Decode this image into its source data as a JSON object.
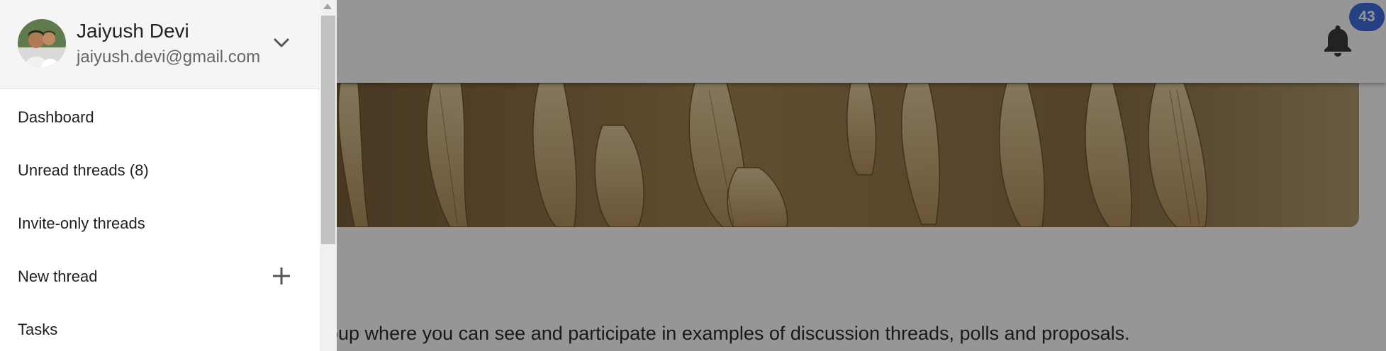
{
  "drawer": {
    "user": {
      "name": "Jaiyush Devi",
      "email": "jaiyush.devi@gmail.com",
      "avatar_icon": "avatar-photo",
      "toggle_icon": "chevron-down-icon"
    },
    "menu": [
      {
        "label": "Dashboard"
      },
      {
        "label": "Unread threads (8)"
      },
      {
        "label": "Invite-only threads"
      },
      {
        "label": "New thread",
        "icon": "plus-icon"
      },
      {
        "label": "Tasks"
      }
    ]
  },
  "header": {
    "notification_icon": "bell-icon",
    "notification_count": "43"
  },
  "main": {
    "description": "oup where you can see and participate in examples of discussion threads, polls and proposals."
  },
  "colors": {
    "badge": "#3f6fe0",
    "scrim": "rgba(0,0,0,0.41)",
    "drawer_header_bg": "#f5f5f5"
  }
}
